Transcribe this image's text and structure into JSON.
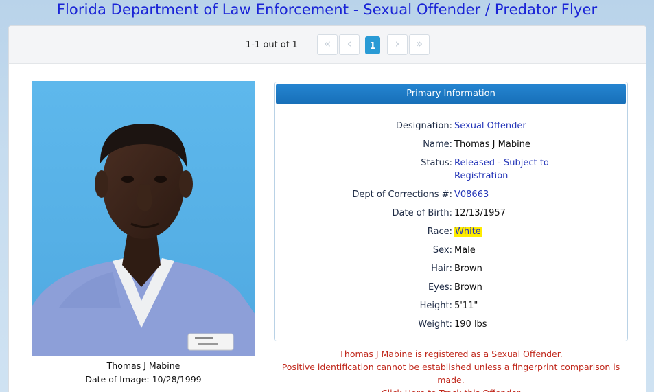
{
  "page": {
    "title": "Florida Department of Law Enforcement - Sexual Offender / Predator Flyer"
  },
  "pager": {
    "count_text": "1-1 out of 1",
    "first_symbol": "«",
    "prev_symbol": "‹",
    "current_page": "1",
    "next_symbol": "›",
    "last_symbol": "»"
  },
  "photo": {
    "name": "Thomas J Mabine",
    "date_of_image": "Date of Image: 10/28/1999"
  },
  "primary_info": {
    "header": "Primary Information",
    "fields": [
      {
        "label": "Designation:",
        "value": "Sexual Offender"
      },
      {
        "label": "Name:",
        "value": "Thomas J Mabine"
      },
      {
        "label": "Status:",
        "value": "Released - Subject to Registration"
      },
      {
        "label": "Dept of Corrections #:",
        "value": "V08663"
      },
      {
        "label": "Date of Birth:",
        "value": "12/13/1957"
      },
      {
        "label": "Race:",
        "value": "White"
      },
      {
        "label": "Sex:",
        "value": "Male"
      },
      {
        "label": "Hair:",
        "value": "Brown"
      },
      {
        "label": "Eyes:",
        "value": "Brown"
      },
      {
        "label": "Height:",
        "value": "5'11\""
      },
      {
        "label": "Weight:",
        "value": "190 lbs"
      }
    ]
  },
  "notice": {
    "line1": "Thomas J Mabine is registered as a Sexual Offender.",
    "line2": "Positive identification cannot be established unless a fingerprint comparison is made.",
    "track_link": "Click Here to Track this Offender"
  },
  "colors": {
    "title_blue": "#1a24d6",
    "header_blue": "#176fb8",
    "link_blue": "#2536b8",
    "highlight": "#ffec00",
    "notice_red": "#c0281c",
    "active_page": "#2a9bd5"
  }
}
